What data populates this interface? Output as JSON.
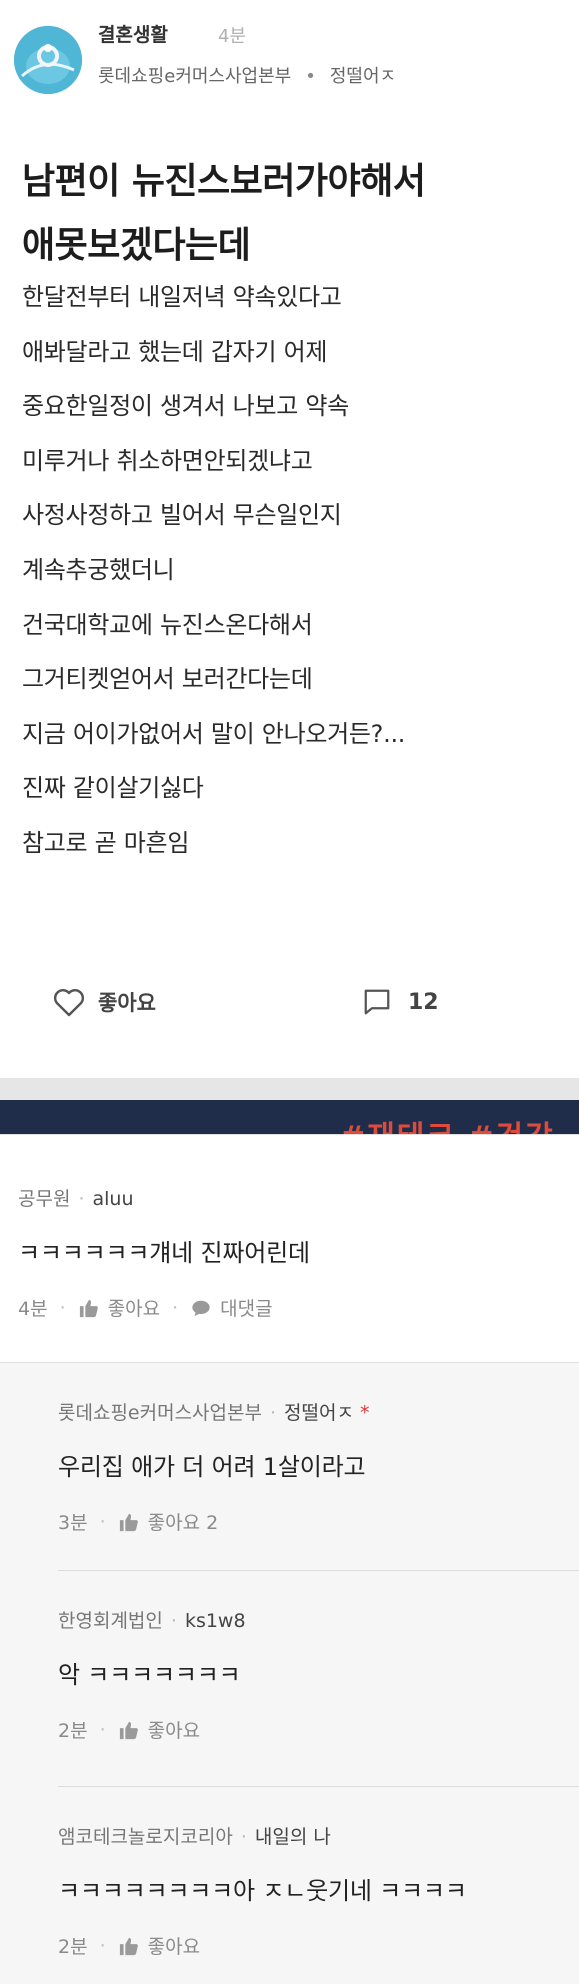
{
  "post": {
    "board": "결혼생활",
    "time": "4분",
    "company": "롯데쇼핑e커머스사업본부",
    "separator": "•",
    "author": "정떨어ㅈ",
    "title_lines": [
      "남편이 뉴진스보러가야해서",
      "애못보겠다는데"
    ],
    "body_lines": [
      "한달전부터 내일저녁 약속있다고",
      "애봐달라고 했는데 갑자기 어제",
      "중요한일정이 생겨서 나보고 약속",
      "미루거나 취소하면안되겠냐고",
      "사정사정하고 빌어서 무슨일인지",
      "계속추궁했더니",
      "건국대학교에 뉴진스온다해서",
      "그거티켓얻어서 보러간다는데",
      "지금 어이가없어서 말이 안나오거든?...",
      "진짜 같이살기싫다",
      "참고로 곧 마흔임"
    ],
    "like_label": "좋아요",
    "comment_count": "12"
  },
  "banner": {
    "text": "#재테크  #건강"
  },
  "comments": [
    {
      "company": "공무원",
      "nick": "aluu",
      "text": "ㅋㅋㅋㅋㅋㅋ걔네 진짜어린데",
      "time": "4분",
      "like": "좋아요",
      "reply": "대댓글"
    }
  ],
  "replies": [
    {
      "company": "롯데쇼핑e커머스사업본부",
      "nick": "정떨어ㅈ",
      "star": "*",
      "text": "우리집 애가 더 어려 1살이라고",
      "time": "3분",
      "like": "좋아요 2"
    },
    {
      "company": "한영회계법인",
      "nick": "ks1w8",
      "text": "악 ㅋㅋㅋㅋㅋㅋㅋ",
      "time": "2분",
      "like": "좋아요"
    },
    {
      "company": "앰코테크놀로지코리아",
      "nick": "내일의 나",
      "text": "ㅋㅋㅋㅋㅋㅋㅋㅋ아 ㅈㄴ웃기네 ㅋㅋㅋㅋ",
      "time": "2분",
      "like": "좋아요"
    }
  ]
}
